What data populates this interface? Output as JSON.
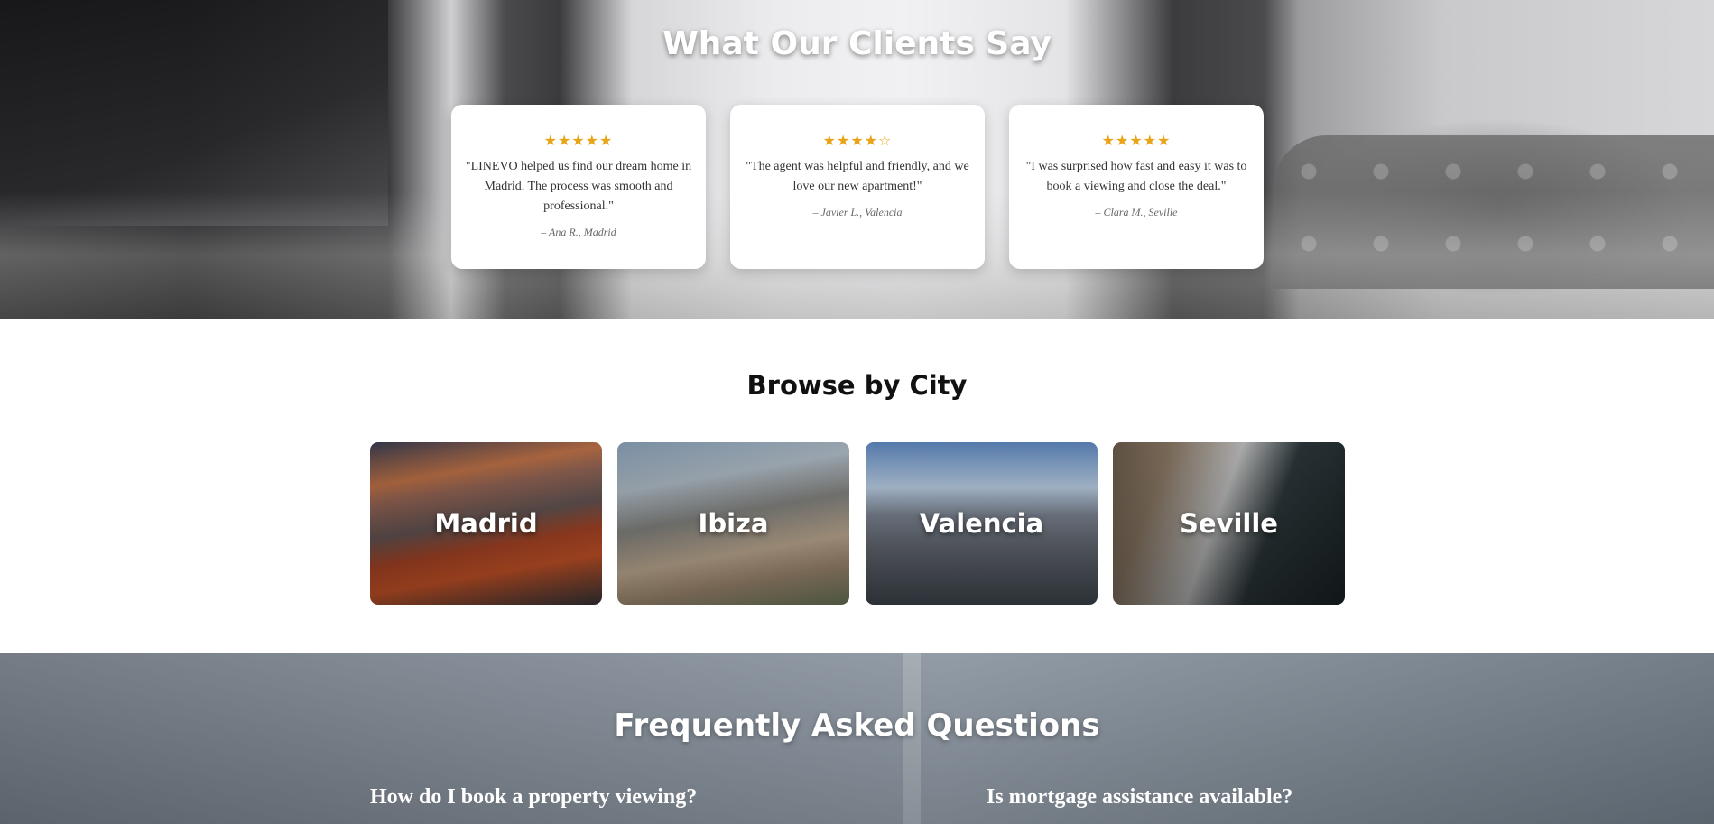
{
  "testimonials": {
    "title": "What Our Clients Say",
    "reviews": [
      {
        "stars": "★★★★★",
        "rating": 5,
        "quote": "\"LINEVO helped us find our dream home in Madrid. The process was smooth and professional.\"",
        "author": "– Ana R., Madrid"
      },
      {
        "stars": "★★★★☆",
        "rating": 4,
        "quote": "\"The agent was helpful and friendly, and we love our new apartment!\"",
        "author": "– Javier L., Valencia"
      },
      {
        "stars": "★★★★★",
        "rating": 5,
        "quote": "\"I was surprised how fast and easy it was to book a viewing and close the deal.\"",
        "author": "– Clara M., Seville"
      }
    ],
    "star_color": "#e8a317"
  },
  "cities": {
    "title": "Browse by City",
    "items": [
      {
        "name": "Madrid"
      },
      {
        "name": "Ibiza"
      },
      {
        "name": "Valencia"
      },
      {
        "name": "Seville"
      }
    ]
  },
  "faq": {
    "title": "Frequently Asked Questions",
    "questions": [
      "How do I book a property viewing?",
      "Is mortgage assistance available?"
    ]
  }
}
